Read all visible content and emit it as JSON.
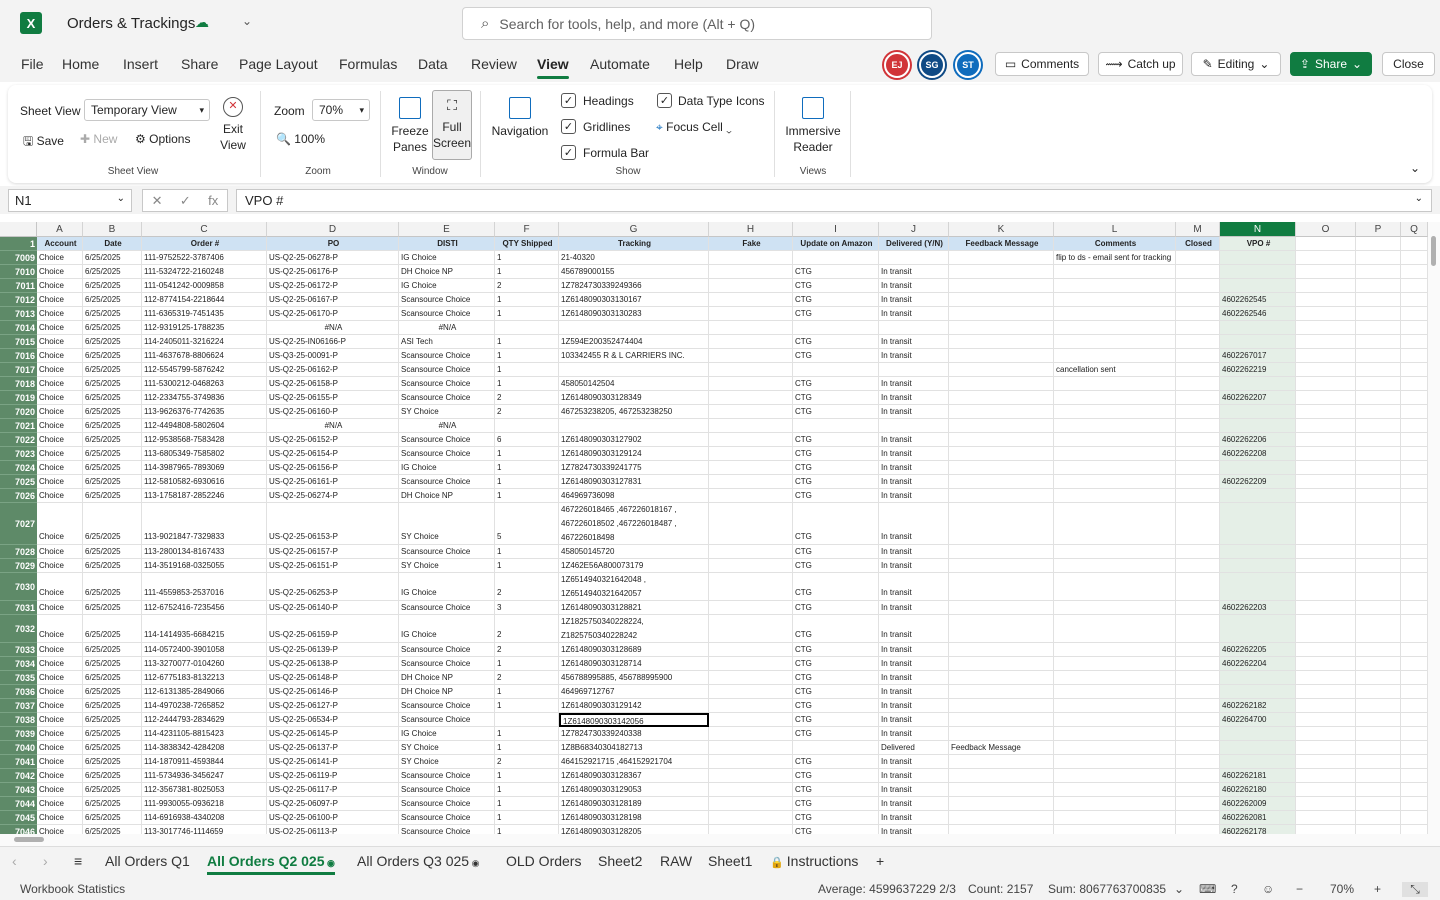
{
  "app": {
    "title": "Orders & Trackings",
    "logo": "X",
    "search_placeholder": "Search for tools, help, and more (Alt + Q)"
  },
  "menus": [
    "File",
    "Home",
    "Insert",
    "Share",
    "Page Layout",
    "Formulas",
    "Data",
    "Review",
    "View",
    "Automate",
    "Help",
    "Draw"
  ],
  "active_menu": "View",
  "avatars": [
    {
      "initials": "EJ",
      "color": "#d13438"
    },
    {
      "initials": "SG",
      "color": "#0f4a85"
    },
    {
      "initials": "ST",
      "color": "#0f6cbd"
    }
  ],
  "top_buttons": {
    "comments": "Comments",
    "catchup": "Catch up",
    "editing": "Editing",
    "share": "Share",
    "close": "Close"
  },
  "ribbon": {
    "sheet_view_label": "Sheet View",
    "sheet_view_value": "Temporary View",
    "save": "Save",
    "new": "New",
    "options": "Options",
    "exit_view": "Exit View",
    "group_sheet_view": "Sheet View",
    "zoom_label": "Zoom",
    "zoom_value": "70%",
    "zoom_100": "100%",
    "group_zoom": "Zoom",
    "freeze_panes": "Freeze Panes",
    "full_screen": "Full Screen",
    "group_window": "Window",
    "navigation": "Navigation",
    "headings": "Headings",
    "gridlines": "Gridlines",
    "formula_bar": "Formula Bar",
    "data_type_icons": "Data Type Icons",
    "focus_cell": "Focus Cell",
    "group_show": "Show",
    "immersive_reader": "Immersive Reader",
    "group_views": "Views"
  },
  "formula_bar": {
    "name_box": "N1",
    "fx": "fx",
    "content": "VPO #"
  },
  "columns": [
    "A",
    "B",
    "C",
    "D",
    "E",
    "F",
    "G",
    "H",
    "I",
    "J",
    "K",
    "L",
    "M",
    "N",
    "O",
    "P",
    "Q"
  ],
  "headers": [
    "Account",
    "Date",
    "Order #",
    "PO",
    "DISTI",
    "QTY Shipped",
    "Tracking",
    "Fake",
    "Update on Amazon",
    "Delivered (Y/N)",
    "Feedback Message",
    "Comments",
    "Closed",
    "VPO #",
    "",
    "",
    ""
  ],
  "rows": [
    {
      "n": "7009",
      "c": [
        "Choice",
        "6/25/2025",
        "111-9752522-3787406",
        "US-Q2-25-06278-P",
        "IG Choice",
        "1",
        "21-40320",
        "",
        "",
        "",
        "",
        "flip to ds - email sent for tracking",
        "",
        ""
      ]
    },
    {
      "n": "7010",
      "c": [
        "Choice",
        "6/25/2025",
        "111-5324722-2160248",
        "US-Q2-25-06176-P",
        "DH Choice NP",
        "1",
        "456789000155",
        "",
        "CTG",
        "In transit",
        "",
        "",
        "",
        ""
      ]
    },
    {
      "n": "7011",
      "c": [
        "Choice",
        "6/25/2025",
        "111-0541242-0009858",
        "US-Q2-25-06172-P",
        "IG Choice",
        "2",
        "1Z7824730339249366",
        "",
        "CTG",
        "In transit",
        "",
        "",
        "",
        ""
      ]
    },
    {
      "n": "7012",
      "c": [
        "Choice",
        "6/25/2025",
        "112-8774154-2218644",
        "US-Q2-25-06167-P",
        "Scansource Choice",
        "1",
        "1Z6148090303130167",
        "",
        "CTG",
        "In transit",
        "",
        "",
        "",
        "4602262545"
      ]
    },
    {
      "n": "7013",
      "c": [
        "Choice",
        "6/25/2025",
        "111-6365319-7451435",
        "US-Q2-25-06170-P",
        "Scansource Choice",
        "1",
        "1Z6148090303130283",
        "",
        "CTG",
        "In transit",
        "",
        "",
        "",
        "4602262546"
      ]
    },
    {
      "n": "7014",
      "c": [
        "Choice",
        "6/25/2025",
        "112-9319125-1788235",
        "#N/A",
        "#N/A",
        "",
        "",
        "",
        "",
        "",
        "",
        "",
        "",
        ""
      ]
    },
    {
      "n": "7015",
      "c": [
        "Choice",
        "6/25/2025",
        "114-2405011-3216224",
        "US-Q2-25-IN06166-P",
        "ASI Tech",
        "1",
        "1Z594E200352474404",
        "",
        "CTG",
        "In transit",
        "",
        "",
        "",
        ""
      ]
    },
    {
      "n": "7016",
      "c": [
        "Choice",
        "6/25/2025",
        "111-4637678-8806624",
        "US-Q3-25-00091-P",
        "Scansource Choice",
        "1",
        "103342455 R & L CARRIERS INC.",
        "",
        "CTG",
        "In transit",
        "",
        "",
        "",
        "4602267017"
      ]
    },
    {
      "n": "7017",
      "c": [
        "Choice",
        "6/25/2025",
        "112-5545799-5876242",
        "US-Q2-25-06162-P",
        "Scansource Choice",
        "1",
        "",
        "",
        "",
        "",
        "",
        "cancellation sent",
        "",
        "4602262219"
      ]
    },
    {
      "n": "7018",
      "c": [
        "Choice",
        "6/25/2025",
        "111-5300212-0468263",
        "US-Q2-25-06158-P",
        "Scansource Choice",
        "1",
        "458050142504",
        "",
        "CTG",
        "In transit",
        "",
        "",
        "",
        ""
      ]
    },
    {
      "n": "7019",
      "c": [
        "Choice",
        "6/25/2025",
        "112-2334755-3749836",
        "US-Q2-25-06155-P",
        "Scansource Choice",
        "2",
        "1Z6148090303128349",
        "",
        "CTG",
        "In transit",
        "",
        "",
        "",
        "4602262207"
      ]
    },
    {
      "n": "7020",
      "c": [
        "Choice",
        "6/25/2025",
        "113-9626376-7742635",
        "US-Q2-25-06160-P",
        "SY Choice",
        "2",
        "467253238205, 467253238250",
        "",
        "CTG",
        "In transit",
        "",
        "",
        "",
        ""
      ]
    },
    {
      "n": "7021",
      "c": [
        "Choice",
        "6/25/2025",
        "112-4494808-5802604",
        "#N/A",
        "#N/A",
        "",
        "",
        "",
        "",
        "",
        "",
        "",
        "",
        ""
      ]
    },
    {
      "n": "7022",
      "c": [
        "Choice",
        "6/25/2025",
        "112-9538568-7583428",
        "US-Q2-25-06152-P",
        "Scansource Choice",
        "6",
        "1Z6148090303127902",
        "",
        "CTG",
        "In transit",
        "",
        "",
        "",
        "4602262206"
      ]
    },
    {
      "n": "7023",
      "c": [
        "Choice",
        "6/25/2025",
        "113-6805349-7585802",
        "US-Q2-25-06154-P",
        "Scansource Choice",
        "1",
        "1Z6148090303129124",
        "",
        "CTG",
        "In transit",
        "",
        "",
        "",
        "4602262208"
      ]
    },
    {
      "n": "7024",
      "c": [
        "Choice",
        "6/25/2025",
        "114-3987965-7893069",
        "US-Q2-25-06156-P",
        "IG Choice",
        "1",
        "1Z7824730339241775",
        "",
        "CTG",
        "In transit",
        "",
        "",
        "",
        ""
      ]
    },
    {
      "n": "7025",
      "c": [
        "Choice",
        "6/25/2025",
        "112-5810582-6930616",
        "US-Q2-25-06161-P",
        "Scansource Choice",
        "1",
        "1Z6148090303127831",
        "",
        "CTG",
        "In transit",
        "",
        "",
        "",
        "4602262209"
      ]
    },
    {
      "n": "7026",
      "c": [
        "Choice",
        "6/25/2025",
        "113-1758187-2852246",
        "US-Q2-25-06274-P",
        "DH Choice NP",
        "1",
        "464969736098",
        "",
        "CTG",
        "In transit",
        "",
        "",
        "",
        ""
      ]
    },
    {
      "n": "7027",
      "h": 3,
      "c": [
        "Choice",
        "6/25/2025",
        "113-9021847-7329833",
        "US-Q2-25-06153-P",
        "SY Choice",
        "5",
        "467226018465 ,467226018167 ,\n467226018502 ,467226018487 ,\n467226018498",
        "",
        "CTG",
        "In transit",
        "",
        "",
        "",
        ""
      ]
    },
    {
      "n": "7028",
      "c": [
        "Choice",
        "6/25/2025",
        "113-2800134-8167433",
        "US-Q2-25-06157-P",
        "Scansource Choice",
        "1",
        "458050145720",
        "",
        "CTG",
        "In transit",
        "",
        "",
        "",
        ""
      ]
    },
    {
      "n": "7029",
      "c": [
        "Choice",
        "6/25/2025",
        "114-3519168-0325055",
        "US-Q2-25-06151-P",
        "SY Choice",
        "1",
        "1Z462E56A800073179",
        "",
        "CTG",
        "In transit",
        "",
        "",
        "",
        ""
      ]
    },
    {
      "n": "7030",
      "h": 2,
      "c": [
        "Choice",
        "6/25/2025",
        "111-4559853-2537016",
        "US-Q2-25-06253-P",
        "IG Choice",
        "2",
        "1Z6514940321642048 ,\n1Z6514940321642057",
        "",
        "CTG",
        "In transit",
        "",
        "",
        "",
        ""
      ]
    },
    {
      "n": "7031",
      "c": [
        "Choice",
        "6/25/2025",
        "112-6752416-7235456",
        "US-Q2-25-06140-P",
        "Scansource Choice",
        "3",
        "1Z6148090303128821",
        "",
        "CTG",
        "In transit",
        "",
        "",
        "",
        "4602262203"
      ]
    },
    {
      "n": "7032",
      "h": 2,
      "c": [
        "Choice",
        "6/25/2025",
        "114-1414935-6684215",
        "US-Q2-25-06159-P",
        "IG Choice",
        "2",
        "1Z1825750340228224,\nZ1825750340228242",
        "",
        "CTG",
        "In transit",
        "",
        "",
        "",
        ""
      ]
    },
    {
      "n": "7033",
      "c": [
        "Choice",
        "6/25/2025",
        "114-0572400-3901058",
        "US-Q2-25-06139-P",
        "Scansource Choice",
        "2",
        "1Z6148090303128689",
        "",
        "CTG",
        "In transit",
        "",
        "",
        "",
        "4602262205"
      ]
    },
    {
      "n": "7034",
      "c": [
        "Choice",
        "6/25/2025",
        "113-3270077-0104260",
        "US-Q2-25-06138-P",
        "Scansource Choice",
        "1",
        "1Z6148090303128714",
        "",
        "CTG",
        "In transit",
        "",
        "",
        "",
        "4602262204"
      ]
    },
    {
      "n": "7035",
      "c": [
        "Choice",
        "6/25/2025",
        "112-6775183-8132213",
        "US-Q2-25-06148-P",
        "DH Choice NP",
        "2",
        "456788995885, 456788995900",
        "",
        "CTG",
        "In transit",
        "",
        "",
        "",
        ""
      ]
    },
    {
      "n": "7036",
      "c": [
        "Choice",
        "6/25/2025",
        "112-6131385-2849066",
        "US-Q2-25-06146-P",
        "DH Choice NP",
        "1",
        "464969712767",
        "",
        "CTG",
        "In transit",
        "",
        "",
        "",
        ""
      ]
    },
    {
      "n": "7037",
      "c": [
        "Choice",
        "6/25/2025",
        "114-4970238-7265852",
        "US-Q2-25-06127-P",
        "Scansource Choice",
        "1",
        "1Z6148090303129142",
        "",
        "CTG",
        "In transit",
        "",
        "",
        "",
        "4602262182"
      ]
    },
    {
      "n": "7038",
      "c": [
        "Choice",
        "6/25/2025",
        "112-2444793-2834629",
        "US-Q2-25-06534-P",
        "Scansource Choice",
        "",
        "1Z6148090303142056",
        "",
        "CTG",
        "In transit",
        "",
        "",
        "",
        "4602264700"
      ]
    },
    {
      "n": "7039",
      "c": [
        "Choice",
        "6/25/2025",
        "114-4231105-8815423",
        "US-Q2-25-06145-P",
        "IG Choice",
        "1",
        "1Z7824730339240338",
        "",
        "CTG",
        "In transit",
        "",
        "",
        "",
        ""
      ]
    },
    {
      "n": "7040",
      "c": [
        "Choice",
        "6/25/2025",
        "114-3838342-4284208",
        "US-Q2-25-06137-P",
        "SY Choice",
        "1",
        "1Z8B68340304182713",
        "",
        "",
        "Delivered",
        "Feedback Message",
        "",
        "",
        ""
      ]
    },
    {
      "n": "7041",
      "c": [
        "Choice",
        "6/25/2025",
        "114-1870911-4593844",
        "US-Q2-25-06141-P",
        "SY Choice",
        "2",
        "464152921715 ,464152921704",
        "",
        "CTG",
        "In transit",
        "",
        "",
        "",
        ""
      ]
    },
    {
      "n": "7042",
      "c": [
        "Choice",
        "6/25/2025",
        "111-5734936-3456247",
        "US-Q2-25-06119-P",
        "Scansource Choice",
        "1",
        "1Z6148090303128367",
        "",
        "CTG",
        "In transit",
        "",
        "",
        "",
        "4602262181"
      ]
    },
    {
      "n": "7043",
      "c": [
        "Choice",
        "6/25/2025",
        "112-3567381-8025053",
        "US-Q2-25-06117-P",
        "Scansource Choice",
        "1",
        "1Z6148090303129053",
        "",
        "CTG",
        "In transit",
        "",
        "",
        "",
        "4602262180"
      ]
    },
    {
      "n": "7044",
      "c": [
        "Choice",
        "6/25/2025",
        "111-9930055-0936218",
        "US-Q2-25-06097-P",
        "Scansource Choice",
        "1",
        "1Z6148090303128189",
        "",
        "CTG",
        "In transit",
        "",
        "",
        "",
        "4602262009"
      ]
    },
    {
      "n": "7045",
      "c": [
        "Choice",
        "6/25/2025",
        "114-6916938-4340208",
        "US-Q2-25-06100-P",
        "Scansource Choice",
        "1",
        "1Z6148090303128198",
        "",
        "CTG",
        "In transit",
        "",
        "",
        "",
        "4602262081"
      ]
    },
    {
      "n": "7046",
      "c": [
        "Choice",
        "6/25/2025",
        "113-3017746-1114659",
        "US-Q2-25-06113-P",
        "Scansource Choice",
        "1",
        "1Z6148090303128205",
        "",
        "CTG",
        "In transit",
        "",
        "",
        "",
        "4602262178"
      ]
    }
  ],
  "sheet_tabs": [
    "All Orders Q1",
    "All Orders Q2 025",
    "All Orders Q3 025",
    "OLD Orders",
    "Sheet2",
    "RAW",
    "Sheet1",
    "Instructions"
  ],
  "active_sheet": "All Orders Q2 025",
  "status": {
    "workbook_statistics": "Workbook Statistics",
    "average": "Average: 4599637229 2/3",
    "count": "Count: 2157",
    "sum": "Sum: 8067763700835",
    "zoom": "70%"
  }
}
